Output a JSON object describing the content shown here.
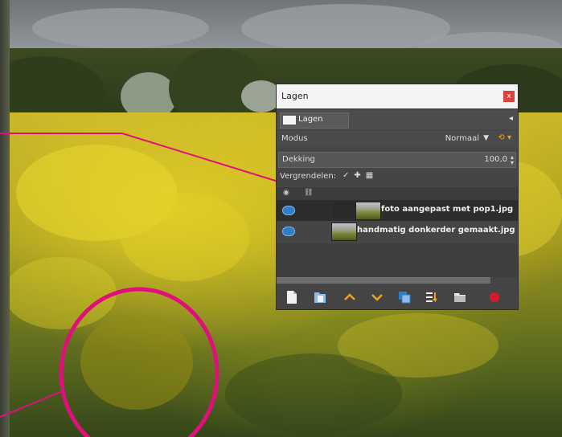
{
  "dialog": {
    "title": "Lagen",
    "close_glyph": "x",
    "tab_label": "Lagen",
    "tab_menu_glyph": "◂",
    "mode_label": "Modus",
    "mode_value": "Normaal",
    "opacity_label": "Dekking",
    "opacity_value": "100,0",
    "lock_label": "Vergrendelen:",
    "layers": [
      {
        "name": "foto aangepast met pop1.jpg",
        "selected": true,
        "visible": true
      },
      {
        "name": "handmatig donkerder gemaakt.jpg",
        "selected": false,
        "visible": true
      }
    ],
    "toolbar_icons": [
      "new-layer-icon",
      "new-layer-group-icon",
      "raise-layer-icon",
      "lower-layer-icon",
      "duplicate-layer-icon",
      "merge-layer-icon",
      "anchor-layer-icon",
      "delete-layer-icon"
    ]
  },
  "colors": {
    "annotation": "#e0107a",
    "accent_orange": "#f0a020",
    "eye_blue": "#2f7ec8"
  }
}
